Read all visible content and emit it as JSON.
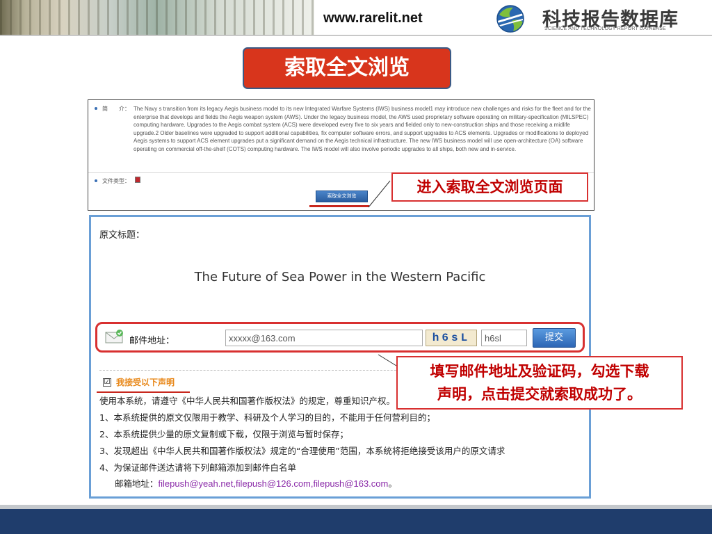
{
  "header": {
    "site_url": "www.rarelit.net",
    "logo_title": "科技报告数据库",
    "logo_subtitle": "SCIENCE AND TECHNOLOGY REPORT DATABASE"
  },
  "slide_title": "索取全文浏览",
  "info_panel": {
    "abstract_label": "简　　介：",
    "abstract_text": "The Navy s transition from its legacy Aegis business model to its new Integrated Warfare Systems (IWS) business model1 may introduce new challenges and risks for the fleet and for the enterprise that develops and fields the Aegis weapon system (AWS). Under the legacy business model, the AWS used proprietary software operating on military-specification (MILSPEC) computing hardware. Upgrades to the Aegis combat system (ACS) were developed every five to six years and fielded only to new-construction ships and those receiving a midlife upgrade.2 Older baselines were upgraded to support additional capabilities, fix computer software errors, and support upgrades to ACS elements. Upgrades or modifications to deployed Aegis systems to support ACS element upgrades put a significant demand on the Aegis technical infrastructure. The new IWS business model will use open-architecture (OA) software operating on commercial off-the-shelf (COTS) computing hardware. The IWS model will also involve periodic upgrades to all ships, both new and in-service.",
    "filetype_label": "文件类型：",
    "request_button": "索取全文浏览"
  },
  "callout_1": "进入索取全文浏览页面",
  "form": {
    "original_title_label": "原文标题：",
    "paper_title": "The Future of Sea Power in the Western Pacific",
    "email_label": "邮件地址：",
    "email_value": "xxxxx@163.com",
    "captcha_text": "h6sL",
    "captcha_input_value": "h6sl",
    "submit_label": "提交",
    "accept_label": "我接受以下声明",
    "checkbox_mark": "☑",
    "terms_intro": "使用本系统，请遵守《中华人民共和国著作版权法》的规定，尊重知识产权。",
    "terms": [
      {
        "num": "1、",
        "text": "本系统提供的原文仅限用于教学、科研及个人学习的目的，不能用于任何营利目的；"
      },
      {
        "num": "2、",
        "text": "本系统提供少量的原文复制或下载，仅限于浏览与暂时保存；"
      },
      {
        "num": "3、",
        "text": "发现超出《中华人民共和国著作版权法》规定的“合理使用”范围，本系统将拒绝接受该用户的原文请求"
      },
      {
        "num": "4、",
        "text": "为保证邮件送达请将下列邮箱添加到邮件白名单"
      }
    ],
    "mailbox_label": "邮箱地址：",
    "mailbox_value": "filepush@yeah.net,filepush@126.com,filepush@163.com",
    "mailbox_end": "。"
  },
  "callout_2": {
    "line1": "填写邮件地址及验证码，勾选下载",
    "line2": "声明，点击提交就索取成功了。"
  },
  "colors": {
    "accent_red": "#d8351c",
    "callout_red": "#c00000",
    "panel_blue": "#6a9fd6",
    "footer_blue": "#1f3d6c",
    "accept_orange": "#e8891c",
    "mailbox_purple": "#8a2aa8"
  }
}
